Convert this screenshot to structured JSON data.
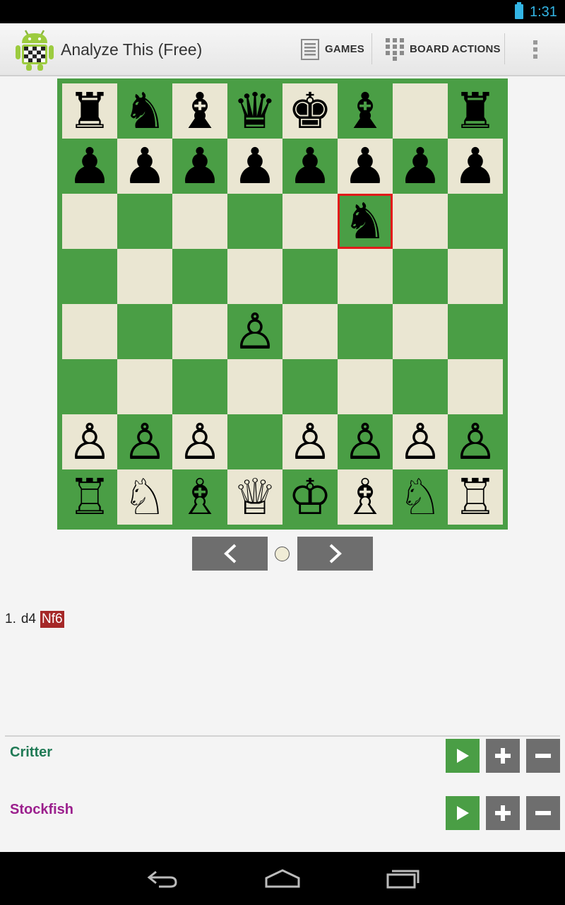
{
  "status_bar": {
    "time": "1:31",
    "battery_icon": "battery-icon"
  },
  "app": {
    "title": "Analyze This (Free)",
    "icon": "android-chessboard-icon"
  },
  "action_bar": {
    "games_label": "GAMES",
    "board_actions_label": "BOARD ACTIONS"
  },
  "colors": {
    "dark_square": "#4a9e45",
    "light_square": "#eae6d2",
    "highlight": "#e21a1a",
    "button_gray": "#6e6e6e",
    "current_move": "#a52828",
    "critter": "#1f7a55",
    "stockfish": "#9b1f8d"
  },
  "board": {
    "highlighted_square": "f6",
    "rows": [
      [
        "♜",
        "♞",
        "♝",
        "♛",
        "♚",
        "♝",
        "",
        "♜"
      ],
      [
        "♟",
        "♟",
        "♟",
        "♟",
        "♟",
        "♟",
        "♟",
        "♟"
      ],
      [
        "",
        "",
        "",
        "",
        "",
        "♞",
        "",
        ""
      ],
      [
        "",
        "",
        "",
        "",
        "",
        "",
        "",
        ""
      ],
      [
        "",
        "",
        "",
        "♙",
        "",
        "",
        "",
        ""
      ],
      [
        "",
        "",
        "",
        "",
        "",
        "",
        "",
        ""
      ],
      [
        "♙",
        "♙",
        "♙",
        "",
        "♙",
        "♙",
        "♙",
        "♙"
      ],
      [
        "♖",
        "♘",
        "♗",
        "♕",
        "♔",
        "♗",
        "♘",
        "♖"
      ]
    ]
  },
  "moves": {
    "number": "1.",
    "white": "d4",
    "black": "Nf6"
  },
  "engines": [
    {
      "name": "Critter"
    },
    {
      "name": "Stockfish"
    }
  ]
}
